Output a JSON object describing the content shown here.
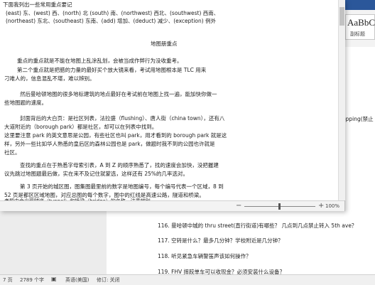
{
  "background_window": {
    "style_gallery": {
      "sample": "AaBbC",
      "name": "副标题"
    },
    "cut_text": "opping(禁止",
    "questions": [
      "116. 曼哈顿中城的 thru street(直行街道)有哪些？ 几点到几点禁止转入 5th ave？",
      "117. 空转是什么？最多几分钟？学校附近是几分钟？",
      "118. 听见紧急车辆警笛声该如何操作？",
      "119. FHV 摔跤单车可以收现金？必须安装什么设备？"
    ]
  },
  "document": {
    "lines": [
      "下面我列出一些常用重点要记",
      "(east) 东、(west) 西、(north) 北 (south) 南、(northwest) 西北、(southwest) 西南、",
      "(northeast) 东北、(southeast) 东南、(add) 增加、(deduct) 减少、(exception) 例外",
      "地图册重点",
      "重点的重点就是不能在地图上乱涂乱划，会被当成作弊行为没收重考。",
      "第二个重点就是把腊的力量的最好买个放大镜来看，考试用地图根本是 TLC 用来",
      "刁难人的，信息混乱不堪，难以辨别。",
      "然后曼哈顿地图的很多地标建筑的地点最好在考试前在地图上找一遍，能加快你做一",
      "些地图题的速度。",
      "封面背后的大白页：是社区列表，法拉盛（flushing）、唐人街（china town），还有八",
      "大道附近的（borough park）都是社区，却可以在列表中找到。",
      "这里要注意 park 的英文意思是公园，有些社区也叫 park，用才看到的 borough park 就是这",
      "样，另外一些比如华人熟悉的皇后区的森林公园也是 park，做题时我不到的公园也许就是",
      "社区。",
      "查找的重点在于熟悉字母索引表，A 到 Z 的顺序熟悉了，找的速度会加快，没把握建",
      "议先跳过地图题最后做，实在来不及记住就蒙选，这样还有 25%的几率选对。",
      "第 3 页开始的城区图，图集图最里前的数字是地图编号，每个编号代表一个区域，8 到",
      "52 页是都区区域地图，对应总图的每个数字，图中的红线是高速公路，隧道和桥梁。",
      "考题中会出现隧道（tunnel）和桥梁（bridge）的名称，注意辨别。"
    ],
    "zoom": "100%"
  },
  "status_bar": {
    "page": "7 页",
    "words": "2789 个字",
    "language": "英语(美国)",
    "track_changes": "修订: 关闭"
  }
}
